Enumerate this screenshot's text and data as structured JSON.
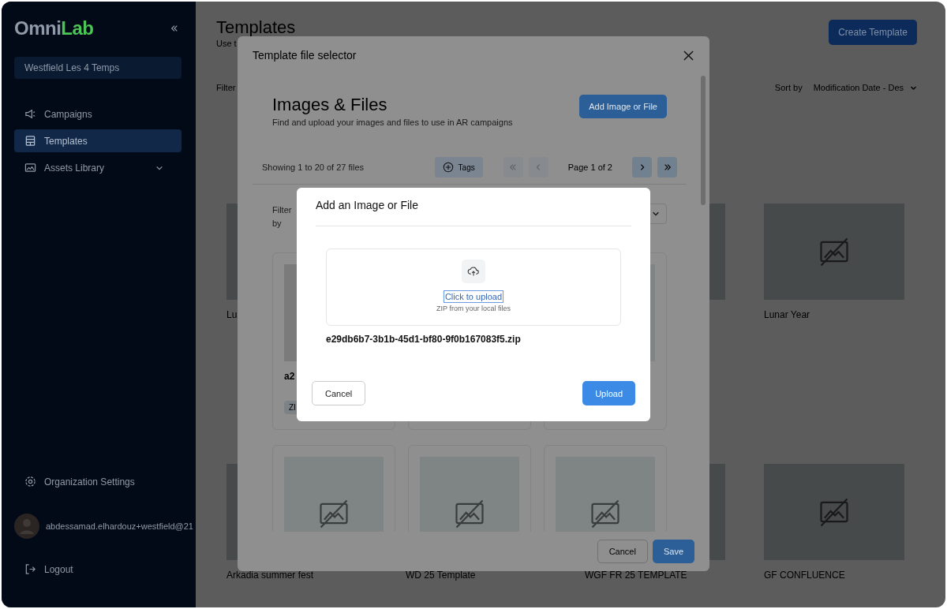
{
  "sidebar": {
    "logo": {
      "first": "Omni",
      "second": "Lab"
    },
    "organization": "Westfield Les 4 Temps",
    "nav": [
      {
        "label": "Campaigns",
        "selected": false
      },
      {
        "label": "Templates",
        "selected": true
      },
      {
        "label": "Assets Library",
        "selected": false,
        "expanded": false
      }
    ],
    "settings": "Organization Settings",
    "user": "abdessamad.elhardouz+westfield@21",
    "logout": "Logout"
  },
  "page": {
    "title": "Templates",
    "subtitle": "Use t",
    "create_button": "Create Template",
    "filter_label": "Filter",
    "sort_label": "Sort by",
    "sort_value": "Modification Date - Des",
    "templates": [
      {
        "label": "Lu"
      },
      {
        "label": "Lunar Year"
      },
      {
        "label": "Arkadia summer fest"
      },
      {
        "label": "WD 25 Template"
      },
      {
        "label": "WGF FR 25 TEMPLATE"
      },
      {
        "label": "GF CONFLUENCE"
      }
    ]
  },
  "file_selector": {
    "title": "Template file selector",
    "heading": "Images & Files",
    "description": "Find and upload your images and files to use in AR campaigns",
    "add_button": "Add Image or File",
    "showing": "Showing 1 to 20 of 27 files",
    "tags_button": "Tags",
    "pager": [
      {
        "kind": "first",
        "disabled": true
      },
      {
        "kind": "prev",
        "disabled": true
      },
      {
        "kind": "page",
        "label": "Page 1 of 2"
      },
      {
        "kind": "next",
        "disabled": false
      },
      {
        "kind": "last",
        "disabled": false
      }
    ],
    "filter_label": "Filter by",
    "files": [
      {
        "kind": "file",
        "name": "a2",
        "tag": "ZI"
      },
      {
        "kind": "placeholder"
      },
      {
        "kind": "placeholder"
      },
      {
        "kind": "placeholder"
      },
      {
        "kind": "placeholder"
      },
      {
        "kind": "placeholder"
      }
    ],
    "cancel_button": "Cancel",
    "save_button": "Save"
  },
  "upload_dialog": {
    "title": "Add an Image or File",
    "link": "Click to upload",
    "link_focused": true,
    "hint": "ZIP from your local files",
    "file": "e29db6b7-3b1b-45d1-bf80-9f0b167083f5.zip",
    "cancel_button": "Cancel",
    "upload_button": "Upload"
  }
}
